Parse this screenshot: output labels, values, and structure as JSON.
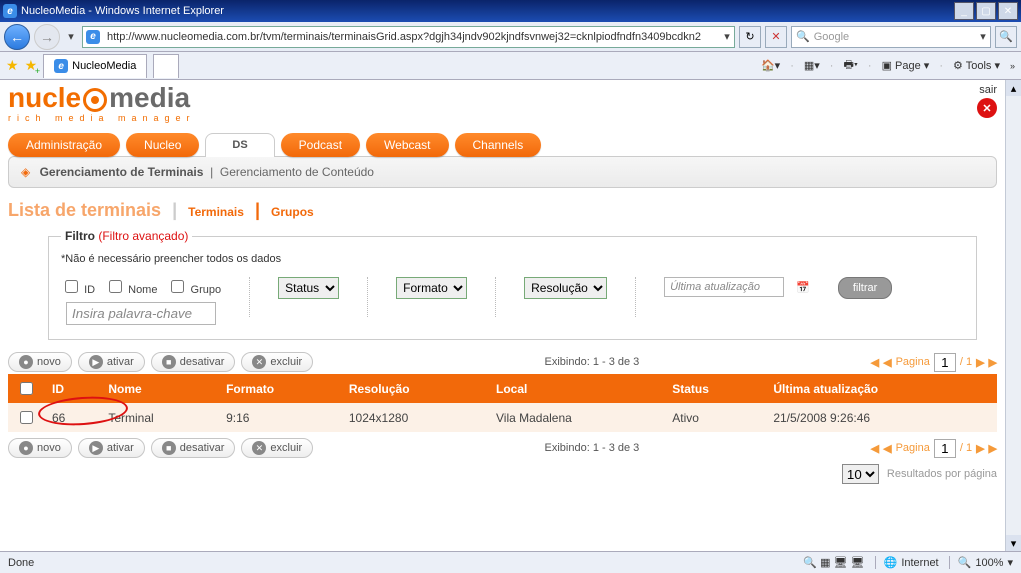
{
  "browser": {
    "title": "NucleoMedia - Windows Internet Explorer",
    "url": "http://www.nucleomedia.com.br/tvm/terminais/terminaisGrid.aspx?dgjh34jndv902kjndfsvnwej32=cknlpiodfndfn3409bcdkn2",
    "search_placeholder": "Google",
    "tab_title": "NucleoMedia",
    "toolbar_right": {
      "page": "Page",
      "tools": "Tools"
    },
    "status_left": "Done",
    "status_zone": "Internet",
    "zoom": "100%"
  },
  "logo": {
    "part1": "nucle",
    "part2": "media",
    "tagline": "rich media manager"
  },
  "exit_label": "sair",
  "main_tabs": {
    "items": [
      "Administração",
      "Nucleo",
      "DS",
      "Podcast",
      "Webcast",
      "Channels"
    ],
    "active": "DS"
  },
  "subnav": {
    "item1": "Gerenciamento de Terminais",
    "item2": "Gerenciamento de Conteúdo"
  },
  "section_title": {
    "title": "Lista de terminais",
    "link1": "Terminais",
    "link2": "Grupos"
  },
  "filter": {
    "legend": "Filtro",
    "legend_extra": "(Filtro avançado)",
    "hint": "*Não é necessário preencher todos os dados",
    "chk_id": "ID",
    "chk_nome": "Nome",
    "chk_grupo": "Grupo",
    "keyword_placeholder": "Insira palavra-chave",
    "sel_status": "Status",
    "sel_formato": "Formato",
    "sel_resolucao": "Resolução",
    "date_placeholder": "Última atualização",
    "btn_filtrar": "filtrar"
  },
  "actions": {
    "novo": "novo",
    "ativar": "ativar",
    "desativar": "desativar",
    "excluir": "excluir"
  },
  "showing": "Exibindo: 1 - 3 de 3",
  "pager": {
    "label": "Pagina",
    "current": "1",
    "total": "/ 1"
  },
  "columns": {
    "id": "ID",
    "nome": "Nome",
    "formato": "Formato",
    "resolucao": "Resolução",
    "local": "Local",
    "status": "Status",
    "ultima": "Última atualização"
  },
  "rows": [
    {
      "id": "66",
      "nome": "Terminal",
      "formato": "9:16",
      "resolucao": "1024x1280",
      "local": "Vila Madalena",
      "status": "Ativo",
      "ultima": "21/5/2008 9:26:46"
    }
  ],
  "results_per_page": {
    "value": "10",
    "label": "Resultados por página"
  }
}
